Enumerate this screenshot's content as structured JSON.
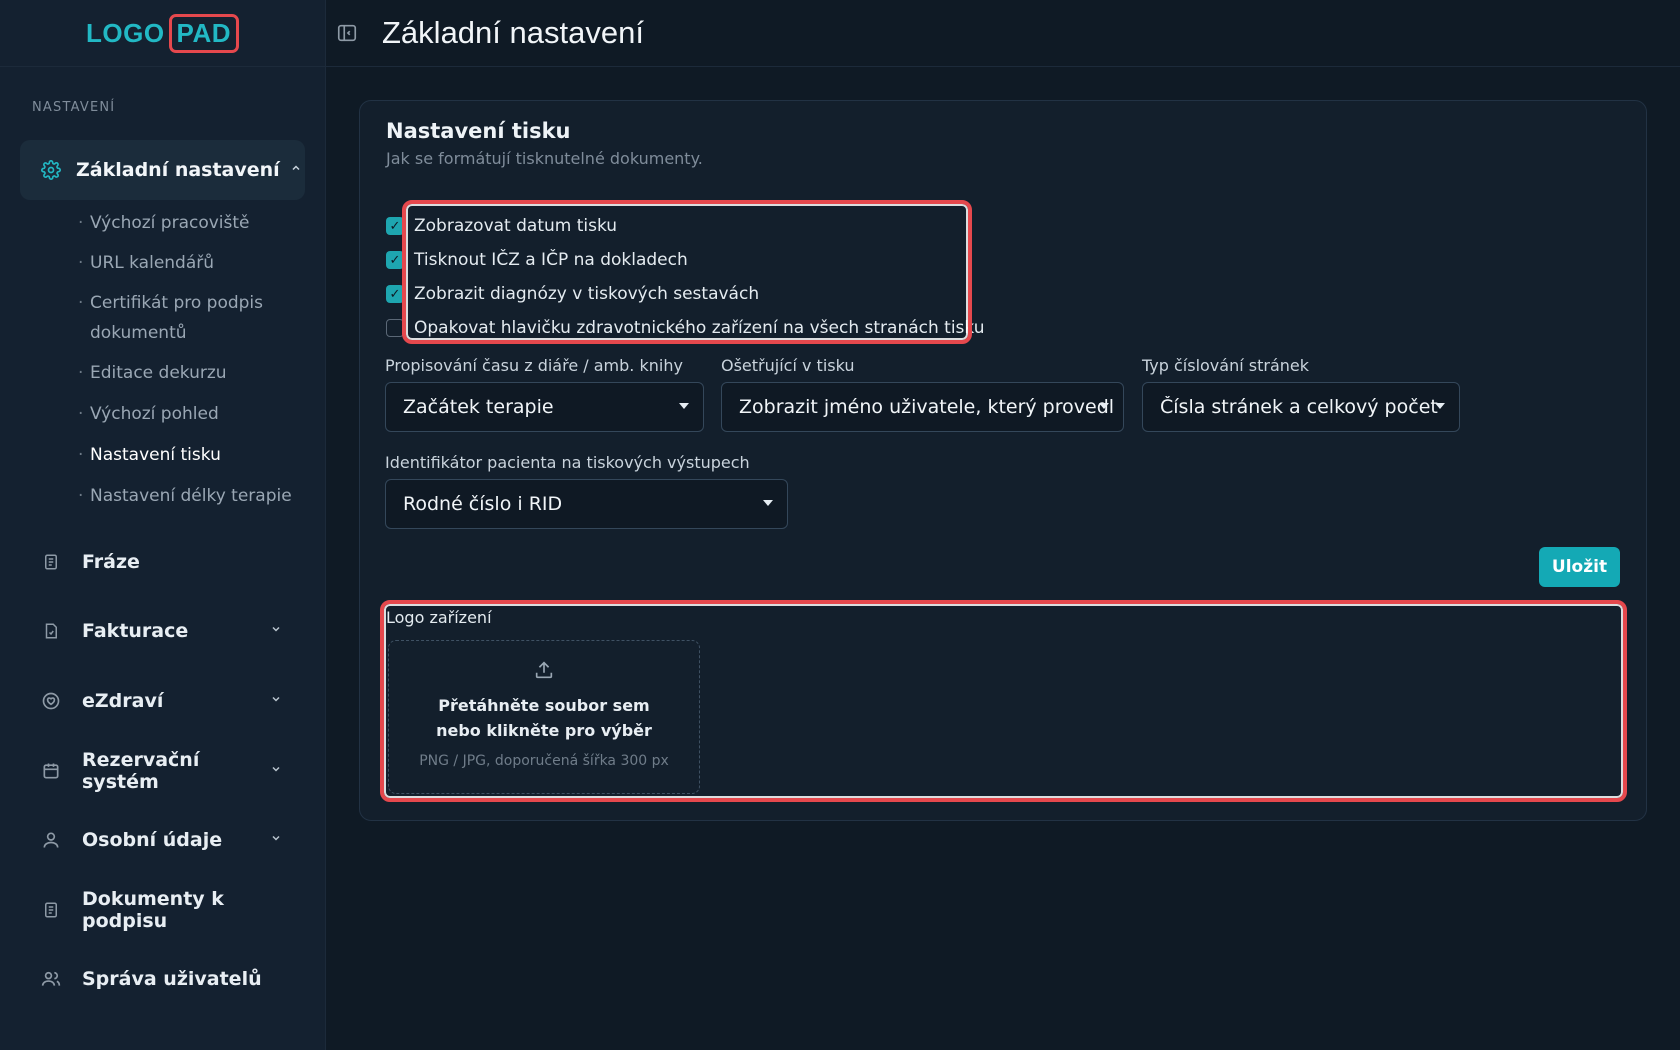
{
  "logo": {
    "part1": "LOGO",
    "part2": "PAD"
  },
  "sidebar": {
    "section_label": "NASTAVENÍ",
    "active_item": {
      "label": "Základní nastavení",
      "icon": "gear-icon"
    },
    "subitems": [
      {
        "label": "Výchozí pracoviště"
      },
      {
        "label": "URL kalendářů"
      },
      {
        "label": "Certifikát pro podpis dokumentů"
      },
      {
        "label": "Editace dekurzu"
      },
      {
        "label": "Výchozí pohled"
      },
      {
        "label": "Nastavení tisku"
      },
      {
        "label": "Nastavení délky terapie"
      }
    ],
    "items": [
      {
        "label": "Fráze",
        "icon": "document-icon"
      },
      {
        "label": "Fakturace",
        "icon": "invoice-icon"
      },
      {
        "label": "eZdraví",
        "icon": "heart-icon"
      },
      {
        "label": "Rezervační systém",
        "icon": "calendar-icon"
      },
      {
        "label": "Osobní údaje",
        "icon": "user-icon"
      },
      {
        "label": "Dokumenty k podpisu",
        "icon": "document-icon"
      },
      {
        "label": "Správa uživatelů",
        "icon": "users-icon"
      }
    ]
  },
  "header": {
    "title": "Základní nastavení"
  },
  "card": {
    "title": "Nastavení tisku",
    "subtitle": "Jak se formátují tisknutelné dokumenty.",
    "checkboxes": [
      {
        "label": "Zobrazovat datum tisku",
        "checked": true
      },
      {
        "label": "Tisknout IČZ a IČP na dokladech",
        "checked": true
      },
      {
        "label": "Zobrazit diagnózy v tiskových sestavách",
        "checked": true
      },
      {
        "label": "Opakovat hlavičku zdravotnického zařízení na všech stranách tisku",
        "checked": false
      }
    ],
    "fields": {
      "time_copy": {
        "label": "Propisování času z diáře / amb. knihy",
        "value": "Začátek terapie"
      },
      "therapist": {
        "label": "Ošetřující v tisku",
        "value": "Zobrazit jméno uživatele, který provedl"
      },
      "page_numbering": {
        "label": "Typ číslování stránek",
        "value": "Čísla stránek a celkový počet"
      },
      "patient_id": {
        "label": "Identifikátor pacienta na tiskových výstupech",
        "value": "Rodné číslo i RID"
      }
    },
    "save_label": "Uložit",
    "logo_upload": {
      "label": "Logo zařízení",
      "main_text": "Přetáhněte soubor sem nebo klikněte pro výběr",
      "hint": "PNG / JPG, doporučená šířka 300 px"
    }
  },
  "colors": {
    "accent": "#14a9b5",
    "highlight": "#e5484d",
    "background": "#0f1a25"
  }
}
